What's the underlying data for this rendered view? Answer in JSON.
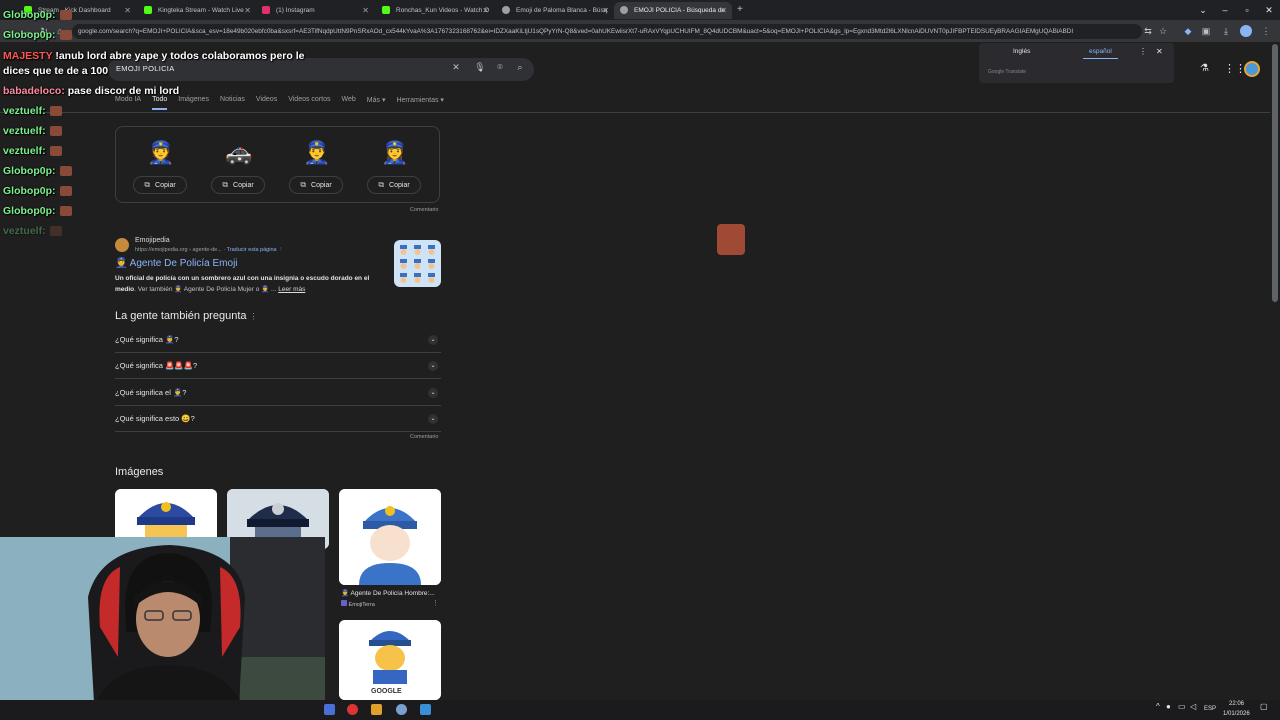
{
  "browser": {
    "tabs": [
      {
        "label": "Stream - Kick Dashboard",
        "color": "#53fc18"
      },
      {
        "label": "Kingteka Stream - Watch Live",
        "color": "#53fc18"
      },
      {
        "label": "(1) Instagram",
        "color": "#e1306c"
      },
      {
        "label": "Ronchas_Kun Videos - Watch O",
        "color": "#53fc18"
      },
      {
        "label": "Emoji de Paloma Blanca - Búsq",
        "color": "#9aa0a6"
      },
      {
        "label": "EMOJI POLICIA - Búsqueda de",
        "color": "#9aa0a6",
        "active": true
      }
    ],
    "url": "google.com/search?q=EMOJI+POLICIA&sca_esv=18e49b020ebfc0ba&sxsrf=AE3TifNqdpUttN9PnSRxAOd_cx544kYvaA%3A1767323168762&ei=IDZXaaKiLtjU1sQPyYrN-Q8&ved=0ahUKEwiisrXt7-uRAxVYqpUCHUIFM_8Q4dUDCBM&uact=5&oq=EMOJI+POLICIA&gs_lp=Egxnd3Mtd2l6LXNlcnAiDUVNT0pJIFBPTElDSUEyBRAAGIAEMgUQABiABDI"
  },
  "translate": {
    "lang1": "Inglés",
    "lang2": "español",
    "brand": "Google Translate"
  },
  "search": {
    "query": "EMOJI POLICIA",
    "tabs": [
      "Modo IA",
      "Todo",
      "Imágenes",
      "Noticias",
      "Videos",
      "Videos cortos",
      "Web",
      "Más ▾",
      "Herramientas ▾"
    ]
  },
  "emoji_card": {
    "emojis": [
      "👮",
      "🚓",
      "👮‍♂️",
      "👮‍♀️"
    ],
    "copy_label": "Copiar",
    "feedback": "Comentario"
  },
  "result": {
    "site": "Emojipedia",
    "url": "https://emojipedia.org › agente-de...",
    "translate": "Traducir esta página",
    "title": "👮 Agente De Policía Emoji",
    "snippet_bold": "Un oficial de policía con un sombrero azul con una insignia o escudo dorado en el medio",
    "snippet": ". Ver también 👮 Agente De Policía Mujer o 👮 ...",
    "more": "Leer más"
  },
  "paa": {
    "title": "La gente también pregunta",
    "questions": [
      "¿Qué significa 👮?",
      "¿Qué significa 🚨🚨🚨?",
      "¿Qué significa el 👮‍♂️?",
      "¿Qué significa esto 😀?"
    ],
    "feedback": "Comentario"
  },
  "images": {
    "title": "Imágenes",
    "caption3": "👮 Agente De Policía Hombre:...",
    "source3": "EmojiTerra",
    "caption6": "GOOGLE"
  },
  "chat": [
    {
      "user": "Globop0p:",
      "msg": "",
      "color": "#7cf08c"
    },
    {
      "user": "Globop0p:",
      "msg": "",
      "color": "#7cf08c"
    },
    {
      "user": "MAJESTY",
      "msg": "!anub lord abre yape y todos colaboramos pero le",
      "color": "#ff5555"
    },
    {
      "user": "",
      "msg": "dices que te de a 100",
      "color": "#ffffff"
    },
    {
      "user": "babadeloco:",
      "msg": "pase discor de mi lord",
      "color": "#ff8aa0"
    },
    {
      "user": "veztuelf:",
      "msg": "",
      "color": "#7cf08c"
    },
    {
      "user": "veztuelf:",
      "msg": "",
      "color": "#7cf08c"
    },
    {
      "user": "veztuelf:",
      "msg": "",
      "color": "#7cf08c"
    },
    {
      "user": "Globop0p:",
      "msg": "",
      "color": "#7cf08c"
    },
    {
      "user": "Globop0p:",
      "msg": "",
      "color": "#7cf08c"
    },
    {
      "user": "Globop0p:",
      "msg": "",
      "color": "#7cf08c"
    },
    {
      "user": "veztuelf:",
      "msg": "",
      "color": "#4a7a50"
    }
  ],
  "taskbar": {
    "lang": "ESP",
    "time": "22:06",
    "date": "1/01/2026"
  }
}
